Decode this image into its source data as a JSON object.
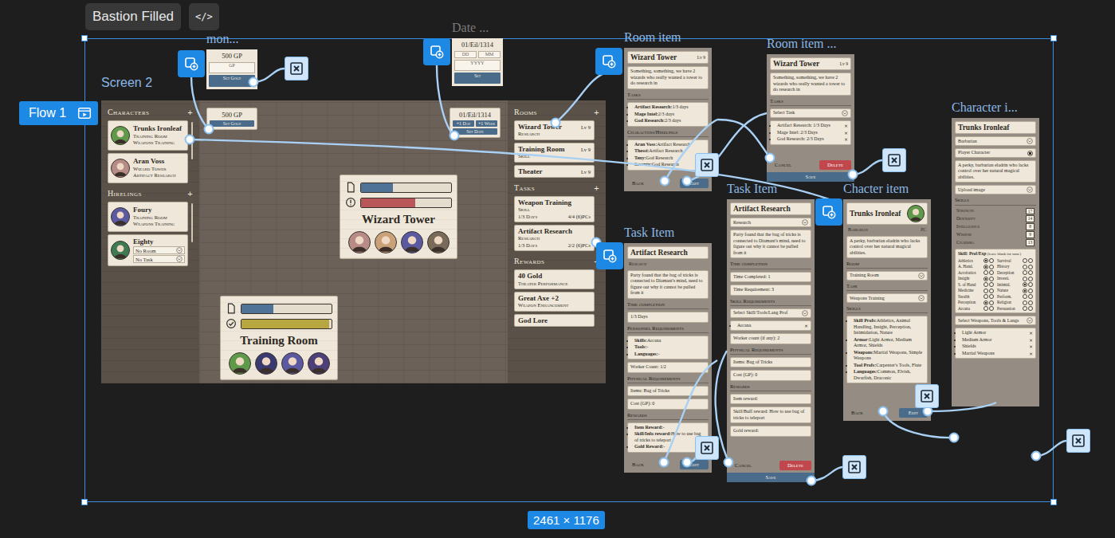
{
  "toolbar": {
    "title": "Bastion Filled",
    "code": "</>"
  },
  "flow": {
    "label": "Flow 1"
  },
  "selection": {
    "size": "2461 × 1176"
  },
  "screen": {
    "label": "Screen 2",
    "characters": {
      "title": "Characters",
      "add": "+",
      "items": [
        {
          "name": "Trunks Ironleaf",
          "room": "Training Room",
          "task": "Weapons Training",
          "kind": "assigned",
          "color": "#5f9a4a"
        },
        {
          "name": "Aran Voss",
          "room": "Wizard Tower",
          "task": "Artifact Research",
          "kind": "assigned",
          "color": "#b78b86"
        }
      ]
    },
    "hirelings": {
      "title": "Hirelings",
      "add": "+",
      "items": [
        {
          "name": "Foury",
          "room": "Training Room",
          "task": "Weapons Training",
          "kind": "assigned",
          "color": "#5b5aa0"
        },
        {
          "name": "Eighty",
          "room": "No Room",
          "task": "No Task",
          "kind": "unassigned",
          "color": "#3f7a52"
        }
      ]
    },
    "gold": {
      "value": "500 GP",
      "button": "Set Gold"
    },
    "date": {
      "value": "01/Eil/1314",
      "buttons": [
        "+1 Day",
        "+1 Week"
      ],
      "set": "Set Date"
    },
    "rooms_map": [
      {
        "title": "Wizard Tower",
        "bars": [
          {
            "kind": "doc",
            "level": 0.35,
            "color": "#4f7396"
          },
          {
            "kind": "alert",
            "level": 0.6,
            "color": "#b9565a"
          }
        ],
        "avatars": [
          "#b78b86",
          "#c9a27a",
          "#5b5aa0",
          "#7a6a5a"
        ]
      },
      {
        "title": "Training Room",
        "bars": [
          {
            "kind": "doc",
            "level": 0.35,
            "color": "#4f7396"
          },
          {
            "kind": "check",
            "level": 0.97,
            "color": "#b8a640"
          }
        ],
        "avatars": [
          "#5f9a4a",
          "#3b3a70",
          "#5b5aa0",
          "#4d3f78"
        ]
      }
    ],
    "rooms": {
      "title": "Rooms",
      "add": "+",
      "items": [
        {
          "name": "Wizard Tower",
          "type": "Research",
          "level": "Lv 9"
        },
        {
          "name": "Training Room",
          "type": "Skill",
          "level": "Lv 9"
        },
        {
          "name": "Theater",
          "level": "Lv 9"
        }
      ]
    },
    "tasks": {
      "title": "Tasks",
      "add": "+",
      "items": [
        {
          "name": "Weapon Training",
          "type": "Skill",
          "days": "1/3 Days",
          "workers": "4/4 (6)PCs"
        },
        {
          "name": "Artifact Research",
          "type": "Research",
          "days": "1/3 Days",
          "workers": "2/2 (6)PCs"
        }
      ]
    },
    "rewards": {
      "title": "Rewards",
      "add": "+",
      "items": [
        {
          "name": "40 Gold",
          "desc": "Theater Performance"
        },
        {
          "name": "Great Axe +2",
          "desc": "Weapon Enhancement"
        },
        {
          "name": "God Lore"
        }
      ]
    }
  },
  "frames": [
    {
      "label": "mon...",
      "highlighted": true,
      "blocks": [
        {
          "kind": "value",
          "text": "500 GP"
        },
        {
          "kind": "input",
          "text": "GP"
        },
        {
          "kind": "button",
          "text": "Set Gold"
        }
      ]
    },
    {
      "label": "Date ...",
      "highlighted": false,
      "blocks": [
        {
          "kind": "value",
          "text": "01/Eil/1314"
        },
        {
          "kind": "inputs",
          "items": [
            "DD",
            "MM"
          ]
        },
        {
          "kind": "input",
          "text": "YYYY"
        },
        {
          "kind": "button",
          "text": "Set"
        }
      ]
    },
    {
      "label": "Room item",
      "highlighted": true,
      "blocks": [
        {
          "kind": "title",
          "text": "Wizard Tower",
          "tag": "Lv 9"
        },
        {
          "kind": "desc",
          "text": "Something, something, we have 2 wizards who really wanted a tower to do research in"
        },
        {
          "kind": "heading",
          "text": "Tasks"
        },
        {
          "kind": "list",
          "items": [
            {
              "label": "Artifact Research:",
              "text": "1/3 days"
            },
            {
              "label": "Mage Intel:",
              "text": "2/3 days"
            },
            {
              "label": "God Research:",
              "text": "2/3 days"
            }
          ]
        },
        {
          "kind": "heading",
          "text": "Characters/Hirelings"
        },
        {
          "kind": "list",
          "items": [
            {
              "label": "Aran Voss:",
              "text": "Artifact Research"
            },
            {
              "label": "Thessi:",
              "text": "Artifact Research"
            },
            {
              "label": "Teny:",
              "text": "God Research"
            },
            {
              "label": "Seventy:",
              "text": "God Research"
            }
          ]
        },
        {
          "kind": "actions",
          "buttons": [
            {
              "label": "Back",
              "kind": "plain"
            },
            {
              "label": "Edit",
              "kind": "primary"
            }
          ]
        }
      ]
    },
    {
      "label": "Room item ...",
      "highlighted": true,
      "blocks": [
        {
          "kind": "title",
          "text": "Wizard Tower",
          "tag": "Lv 9"
        },
        {
          "kind": "desc",
          "text": "Something, something, we have 2 wizards who really wanted a tower to do research in"
        },
        {
          "kind": "heading",
          "text": "Tasks"
        },
        {
          "kind": "select",
          "text": "Select Task"
        },
        {
          "kind": "list",
          "items": [
            {
              "text": "Artifact Research: 1/3 Days",
              "remove": "×"
            },
            {
              "text": "Mage Intel: 2/3 Days",
              "remove": "×"
            },
            {
              "text": "God Research: 2/3 Days",
              "remove": "×"
            }
          ]
        },
        {
          "kind": "actions",
          "buttons": [
            {
              "label": "Cancel",
              "kind": "plain"
            },
            {
              "label": "Delete",
              "kind": "danger"
            }
          ]
        },
        {
          "kind": "bar",
          "text": "Save"
        }
      ]
    },
    {
      "label": "Character i...",
      "highlighted": true,
      "blocks": [
        {
          "kind": "title",
          "text": "Trunks Ironleaf"
        },
        {
          "kind": "select",
          "text": "Barbarian"
        },
        {
          "kind": "radio",
          "text": "Player Character",
          "selected": true
        },
        {
          "kind": "desc",
          "text": "A perky, barbarian eladrin who lacks control over her natural magical abilities."
        },
        {
          "kind": "select",
          "text": "Upload image"
        },
        {
          "kind": "heading",
          "text": "Skills"
        },
        {
          "kind": "stats",
          "items": [
            {
              "label": "Strength",
              "value": "17"
            },
            {
              "label": "Dexterity",
              "value": "14"
            },
            {
              "label": "Intelligence",
              "value": "8"
            },
            {
              "label": "Wisdom",
              "value": "9"
            },
            {
              "label": "Charisma",
              "value": "13"
            }
          ]
        },
        {
          "kind": "skills",
          "title": "Skill: Prof/Exp",
          "note": "(leave blank for none)",
          "items": [
            {
              "name": "Athletics",
              "prof": true,
              "exp": false
            },
            {
              "name": "Survival",
              "prof": false,
              "exp": false
            },
            {
              "name": "A. Hand.",
              "prof": true,
              "exp": false
            },
            {
              "name": "History",
              "prof": false,
              "exp": false
            },
            {
              "name": "Acrobatics",
              "prof": false,
              "exp": false
            },
            {
              "name": "Deception",
              "prof": false,
              "exp": false
            },
            {
              "name": "Insight",
              "prof": true,
              "exp": false
            },
            {
              "name": "Investi.",
              "prof": false,
              "exp": false
            },
            {
              "name": "S. of Hand",
              "prof": false,
              "exp": false
            },
            {
              "name": "Intimid.",
              "prof": true,
              "exp": false
            },
            {
              "name": "Medicine",
              "prof": false,
              "exp": false
            },
            {
              "name": "Nature",
              "prof": true,
              "exp": false
            },
            {
              "name": "Stealth",
              "prof": false,
              "exp": false
            },
            {
              "name": "Perform.",
              "prof": false,
              "exp": false
            },
            {
              "name": "Perception",
              "prof": true,
              "exp": false
            },
            {
              "name": "Religion",
              "prof": false,
              "exp": false
            },
            {
              "name": "Arcana",
              "prof": false,
              "exp": false
            },
            {
              "name": "Persuasion",
              "prof": false,
              "exp": false
            }
          ]
        },
        {
          "kind": "select",
          "text": "Select Weapons, Tools & Langs"
        },
        {
          "kind": "list",
          "items": [
            {
              "text": "Light Armor",
              "remove": "×"
            },
            {
              "text": "Medium Armor",
              "remove": "×"
            },
            {
              "text": "Shields",
              "remove": "×"
            },
            {
              "text": "Martial Weapons",
              "remove": "×"
            }
          ]
        }
      ]
    },
    {
      "label": "Task Item",
      "highlighted": true,
      "blocks": [
        {
          "kind": "title",
          "text": "Artifact Research"
        },
        {
          "kind": "sub",
          "text": "Research"
        },
        {
          "kind": "desc",
          "text": "Party found that the bag of tricks is connected to Diamant's mind, need to figure out why it cannot be pulled from it"
        },
        {
          "kind": "heading",
          "text": "Time completion"
        },
        {
          "kind": "field",
          "text": "1/3 Days"
        },
        {
          "kind": "heading",
          "text": "Personnel Requirements"
        },
        {
          "kind": "list",
          "items": [
            {
              "label": "Skills:",
              "text": "Arcana"
            },
            {
              "label": "Tools:",
              "text": "-"
            },
            {
              "label": "Languages:",
              "text": "-"
            }
          ]
        },
        {
          "kind": "field",
          "text": "Worker Count: 1/2"
        },
        {
          "kind": "heading",
          "text": "Physical Requirements"
        },
        {
          "kind": "field",
          "text": "Items: Bag of Tricks"
        },
        {
          "kind": "field",
          "text": "Cost (GP): 0"
        },
        {
          "kind": "heading",
          "text": "Rewards"
        },
        {
          "kind": "list",
          "items": [
            {
              "label": "Item Reward:",
              "text": "-"
            },
            {
              "label": "Skill/Info reward:",
              "text": "How to use bag of tricks to teleport"
            },
            {
              "label": "Gold Reward:",
              "text": "-"
            }
          ]
        },
        {
          "kind": "actions",
          "buttons": [
            {
              "label": "Back",
              "kind": "plain"
            },
            {
              "label": "Edit",
              "kind": "primary"
            }
          ]
        }
      ]
    },
    {
      "label": "Task Item",
      "highlighted": true,
      "blocks": [
        {
          "kind": "title",
          "text": "Artifact Research"
        },
        {
          "kind": "select",
          "text": "Research"
        },
        {
          "kind": "desc",
          "text": "Party found that the bag of tricks is connected to Diamant's mind, need to figure out why it cannot be pulled from it"
        },
        {
          "kind": "heading",
          "text": "Time completion"
        },
        {
          "kind": "field",
          "text": "Time Completed: 1"
        },
        {
          "kind": "field",
          "text": "Time Requirement: 3"
        },
        {
          "kind": "heading",
          "text": "Skill Requirements"
        },
        {
          "kind": "select",
          "text": "Select Skill/Tools/Lang Prof"
        },
        {
          "kind": "list",
          "items": [
            {
              "text": "Arcana",
              "remove": "×"
            }
          ]
        },
        {
          "kind": "field",
          "text": "Worker count (if any): 2"
        },
        {
          "kind": "heading",
          "text": "Physical Requirements"
        },
        {
          "kind": "field",
          "text": "Items: Bag of Tricks"
        },
        {
          "kind": "field",
          "text": "Cost (GP): 0"
        },
        {
          "kind": "heading",
          "text": "Rewards"
        },
        {
          "kind": "field",
          "text": "Item reward:"
        },
        {
          "kind": "field",
          "text": "Skill/Buff reward: How to use bag of tricks to teleport"
        },
        {
          "kind": "field",
          "text": "Gold reward:"
        },
        {
          "kind": "actions",
          "buttons": [
            {
              "label": "Cancel",
              "kind": "plain"
            },
            {
              "label": "Delete",
              "kind": "danger"
            }
          ]
        },
        {
          "kind": "bar",
          "text": "Save"
        }
      ]
    },
    {
      "label": "Chacter item",
      "highlighted": true,
      "blocks": [
        {
          "kind": "title",
          "text": "Trunks Ironleaf",
          "color": "#5f9a4a"
        },
        {
          "kind": "sub",
          "text": "Barbarian",
          "tag": "PC"
        },
        {
          "kind": "desc",
          "text": "A perky, barbarian eladrin who lacks control over her natural magical abilities."
        },
        {
          "kind": "heading",
          "text": "Room"
        },
        {
          "kind": "select",
          "text": "Training Room"
        },
        {
          "kind": "heading",
          "text": "Task"
        },
        {
          "kind": "select",
          "text": "Weapons Training"
        },
        {
          "kind": "heading",
          "text": "Skills"
        },
        {
          "kind": "list",
          "items": [
            {
              "label": "Skill Profs:",
              "text": "Athletics, Animal Handling, Insight, Perception, Intimidation, Nature"
            },
            {
              "label": "Armor:",
              "text": "Light Armor, Medium Armor, Shields"
            },
            {
              "label": "Weapons:",
              "text": "Martial Weapons, Simple Weapons"
            },
            {
              "label": "Tool Profs:",
              "text": "Carpenter's Tools, Flute"
            },
            {
              "label": "Languages:",
              "text": "Common, Elvish, Dwarfish, Draconic"
            }
          ]
        },
        {
          "kind": "actions",
          "buttons": [
            {
              "label": "Back",
              "kind": "plain"
            },
            {
              "label": "Edit",
              "kind": "primary"
            }
          ]
        }
      ]
    }
  ]
}
